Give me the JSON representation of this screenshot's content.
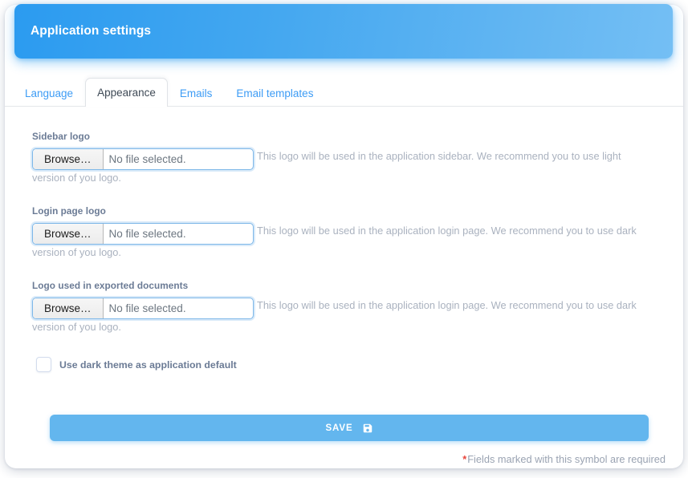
{
  "header": {
    "title": "Application settings"
  },
  "tabs": [
    {
      "label": "Language",
      "active": false
    },
    {
      "label": "Appearance",
      "active": true
    },
    {
      "label": "Emails",
      "active": false
    },
    {
      "label": "Email templates",
      "active": false
    }
  ],
  "fields": [
    {
      "label": "Sidebar logo",
      "browse_label": "Browse…",
      "file_name": "No file selected.",
      "help": "This logo will be used in the application sidebar. We recommend you to use light version of you logo."
    },
    {
      "label": "Login page logo",
      "browse_label": "Browse…",
      "file_name": "No file selected.",
      "help": "This logo will be used in the application login page. We recommend you to use dark version of you logo."
    },
    {
      "label": "Logo used in exported documents",
      "browse_label": "Browse…",
      "file_name": "No file selected.",
      "help": "This logo will be used in the application login page. We recommend you to use dark version of you logo."
    }
  ],
  "dark_theme_checkbox": {
    "label": "Use dark theme as application default",
    "checked": false
  },
  "save_button": {
    "label": "SAVE",
    "icon": "save-floppy-icon"
  },
  "required_note": {
    "symbol": "*",
    "text": "Fields marked with this symbol are required"
  },
  "colors": {
    "header_gradient_start": "#2b9bf0",
    "header_gradient_end": "#74bff4",
    "tab_link": "#3d9cf5",
    "tab_active_text": "#3f4a56",
    "label": "#6b7b95",
    "help_text": "#aab2bf",
    "save_button": "#63b6ee",
    "required_star": "#e8453c"
  }
}
